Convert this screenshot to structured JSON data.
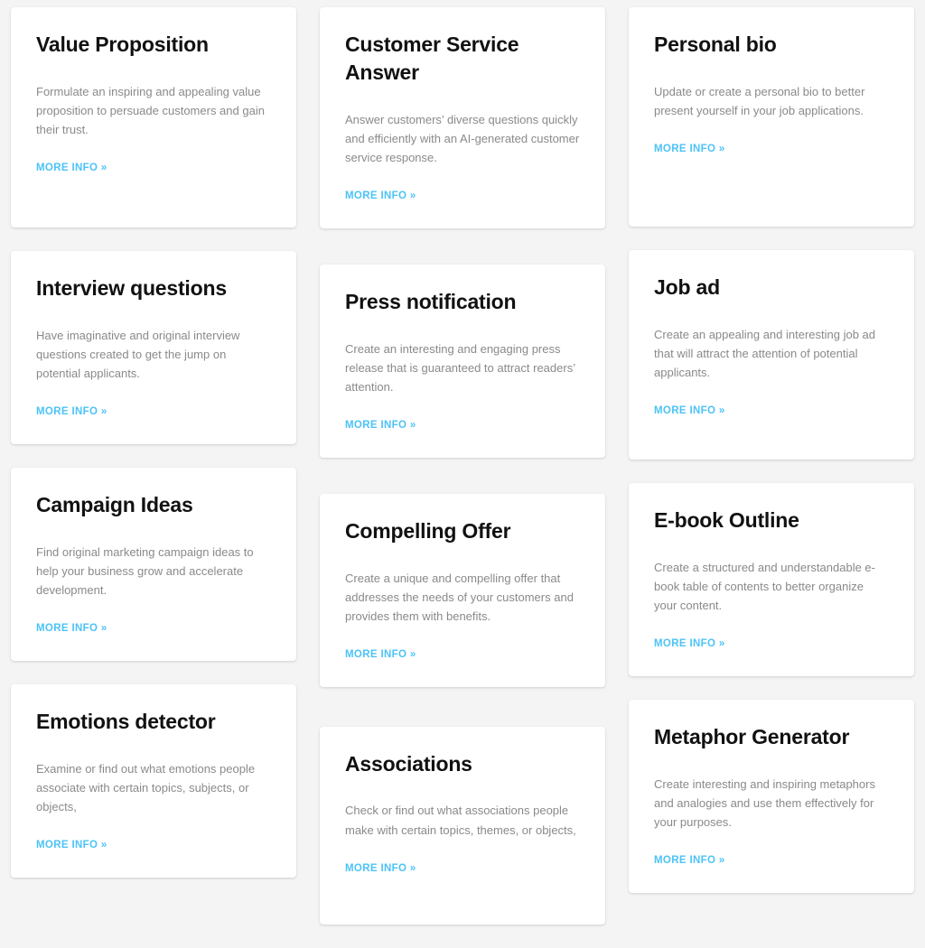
{
  "theme": {
    "page_background": "#f4f4f4",
    "card_background": "#ffffff",
    "title_color": "#111111",
    "description_color": "#8a8a8a",
    "link_color": "#4cc3f7"
  },
  "link_label": "MORE INFO »",
  "columns": [
    {
      "cards": [
        {
          "title": "Value Proposition",
          "description": "Formulate an inspiring and appealing value proposition to persuade customers and gain their trust.",
          "link": "MORE INFO »"
        },
        {
          "title": "Interview questions",
          "description": "Have imaginative and original interview questions created to get the jump on potential applicants.",
          "link": "MORE INFO »"
        },
        {
          "title": "Campaign Ideas",
          "description": "Find original marketing campaign ideas to help your business grow and accelerate development.",
          "link": "MORE INFO »"
        },
        {
          "title": "Emotions detector",
          "description": "Examine or find out what emotions people associate with certain topics, subjects, or objects,",
          "link": "MORE INFO »"
        }
      ]
    },
    {
      "cards": [
        {
          "title": "Customer Service Answer",
          "description": "Answer customers’ diverse questions quickly and efficiently with an AI-generated customer service response.",
          "link": "MORE INFO »"
        },
        {
          "title": "Press notification",
          "description": "Create an interesting and engaging press release that is guaranteed to attract readers’ attention.",
          "link": "MORE INFO »"
        },
        {
          "title": "Compelling Offer",
          "description": "Create a unique and compelling offer that addresses the needs of your customers and provides them with benefits.",
          "link": "MORE INFO »"
        },
        {
          "title": "Associations",
          "description": "Check or find out what associations people make with certain topics, themes, or objects,",
          "link": "MORE INFO »"
        }
      ]
    },
    {
      "cards": [
        {
          "title": "Personal bio",
          "description": "Update or create a personal bio to better present yourself in your job applications.",
          "link": "MORE INFO »"
        },
        {
          "title": "Job ad",
          "description": "Create an appealing and interesting job ad that will attract the attention of potential applicants.",
          "link": "MORE INFO »"
        },
        {
          "title": "E-book Outline",
          "description": "Create a structured and understandable e-book table of contents to better organize your content.",
          "link": "MORE INFO »"
        },
        {
          "title": "Metaphor Generator",
          "description": "Create interesting and inspiring metaphors and analogies and use them effectively for your purposes.",
          "link": "MORE INFO »"
        }
      ]
    }
  ]
}
